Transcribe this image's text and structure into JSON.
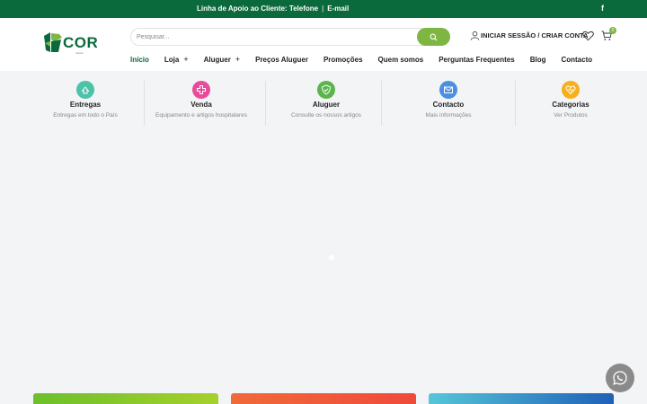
{
  "topbar": {
    "support_text": "Linha de Apoio ao Cliente: Telefone",
    "separator": "|",
    "email_text": "E-mail",
    "social_icon": "f"
  },
  "logo": {
    "word": "COR",
    "sub": "Saúde"
  },
  "search": {
    "placeholder": "Pesquisar..."
  },
  "account": {
    "label": "INICIAR SESSÃO / CRIAR CONTA"
  },
  "cart": {
    "count": "0"
  },
  "nav": {
    "items": [
      {
        "label": "Início",
        "plus": ""
      },
      {
        "label": "Loja",
        "plus": "+"
      },
      {
        "label": "Aluguer",
        "plus": "+"
      },
      {
        "label": "Preços Aluguer",
        "plus": ""
      },
      {
        "label": "Promoções",
        "plus": ""
      },
      {
        "label": "Quem somos",
        "plus": ""
      },
      {
        "label": "Perguntas Frequentes",
        "plus": ""
      },
      {
        "label": "Blog",
        "plus": ""
      },
      {
        "label": "Contacto",
        "plus": ""
      }
    ]
  },
  "features": [
    {
      "title": "Entregas",
      "desc": "Entregas em todo o País",
      "color": "#4cc3a8",
      "icon": "delivery-icon"
    },
    {
      "title": "Venda",
      "desc": "Equipamento e artigos hospitalares",
      "color": "#e94b9a",
      "icon": "plus-cross-icon"
    },
    {
      "title": "Aluguer",
      "desc": "Consulte os nossos artigos",
      "color": "#5ab54c",
      "icon": "shield-check-icon"
    },
    {
      "title": "Contacto",
      "desc": "Mais informações",
      "color": "#4a8fe0",
      "icon": "mail-icon"
    },
    {
      "title": "Categorias",
      "desc": "Ver Produtos",
      "color": "#f5b01a",
      "icon": "heart-pulse-icon"
    }
  ],
  "colors": {
    "brand_green": "#0b6a3b",
    "accent_green": "#7fb543"
  }
}
